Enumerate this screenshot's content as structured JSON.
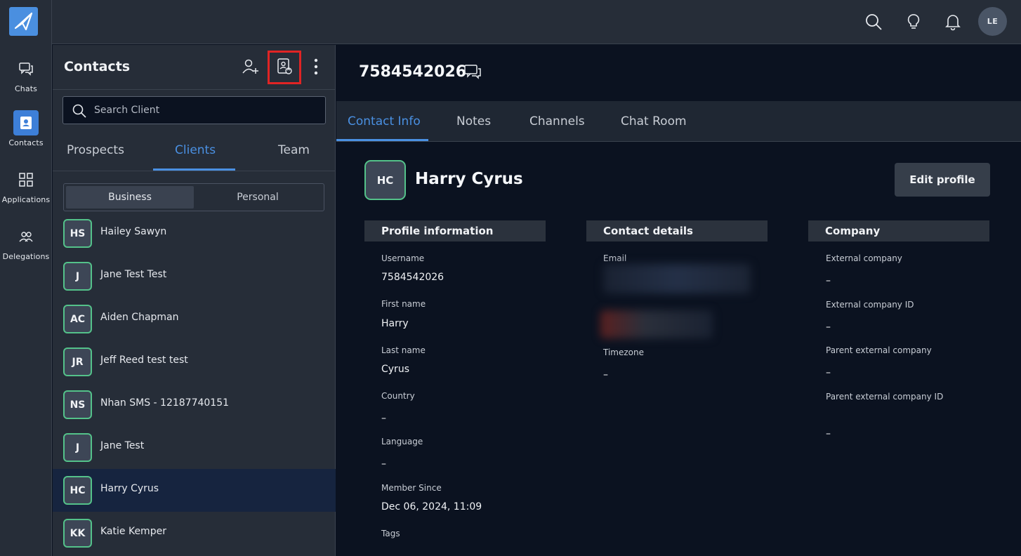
{
  "rail": {
    "items": [
      {
        "label": "Chats",
        "icon": "chat-bubbles-icon"
      },
      {
        "label": "Contacts",
        "icon": "contact-card-icon",
        "active": true
      },
      {
        "label": "Applications",
        "icon": "grid-icon"
      },
      {
        "label": "Delegations",
        "icon": "people-icon"
      }
    ]
  },
  "topbar": {
    "user_initials": "LE",
    "icons": [
      "search-icon",
      "lightbulb-icon",
      "bell-icon"
    ]
  },
  "contacts": {
    "title": "Contacts",
    "search_placeholder": "Search Client",
    "tabs": [
      "Prospects",
      "Clients",
      "Team"
    ],
    "active_tab": "Clients",
    "segments": [
      "Business",
      "Personal"
    ],
    "active_segment": "Business",
    "list": [
      {
        "initials": "HS",
        "name": "Hailey Sawyn"
      },
      {
        "initials": "J",
        "name": "Jane Test Test"
      },
      {
        "initials": "AC",
        "name": "Aiden Chapman"
      },
      {
        "initials": "JR",
        "name": "Jeff Reed test test"
      },
      {
        "initials": "NS",
        "name": "Nhan SMS - 12187740151"
      },
      {
        "initials": "J",
        "name": "Jane Test"
      },
      {
        "initials": "HC",
        "name": "Harry Cyrus",
        "selected": true
      },
      {
        "initials": "KK",
        "name": "Katie Kemper"
      }
    ]
  },
  "detail": {
    "phone": "7584542026",
    "tabs": [
      "Contact Info",
      "Notes",
      "Channels",
      "Chat Room"
    ],
    "active_tab": "Contact Info",
    "avatar_initials": "HC",
    "full_name": "Harry Cyrus",
    "edit_label": "Edit profile",
    "profile": {
      "heading": "Profile information",
      "fields": [
        {
          "label": "Username",
          "value": "7584542026"
        },
        {
          "label": "First name",
          "value": "Harry"
        },
        {
          "label": "Last name",
          "value": "Cyrus"
        },
        {
          "label": "Country",
          "value": "–"
        },
        {
          "label": "Language",
          "value": "–"
        },
        {
          "label": "Member Since",
          "value": "Dec 06, 2024, 11:09"
        },
        {
          "label": "Tags",
          "value": ""
        }
      ]
    },
    "contact": {
      "heading": "Contact details",
      "email_label": "Email",
      "timezone_label": "Timezone",
      "timezone_value": "–"
    },
    "company": {
      "heading": "Company",
      "fields": [
        {
          "label": "External company",
          "value": "–"
        },
        {
          "label": "External company ID",
          "value": "–"
        },
        {
          "label": "Parent external company",
          "value": "–"
        },
        {
          "label": "Parent external company ID",
          "value": "–"
        }
      ]
    }
  },
  "colors": {
    "accent": "#4a90e2",
    "avatar_border": "#54c28a",
    "highlight": "#e02424",
    "selected_row": "#16243f"
  }
}
